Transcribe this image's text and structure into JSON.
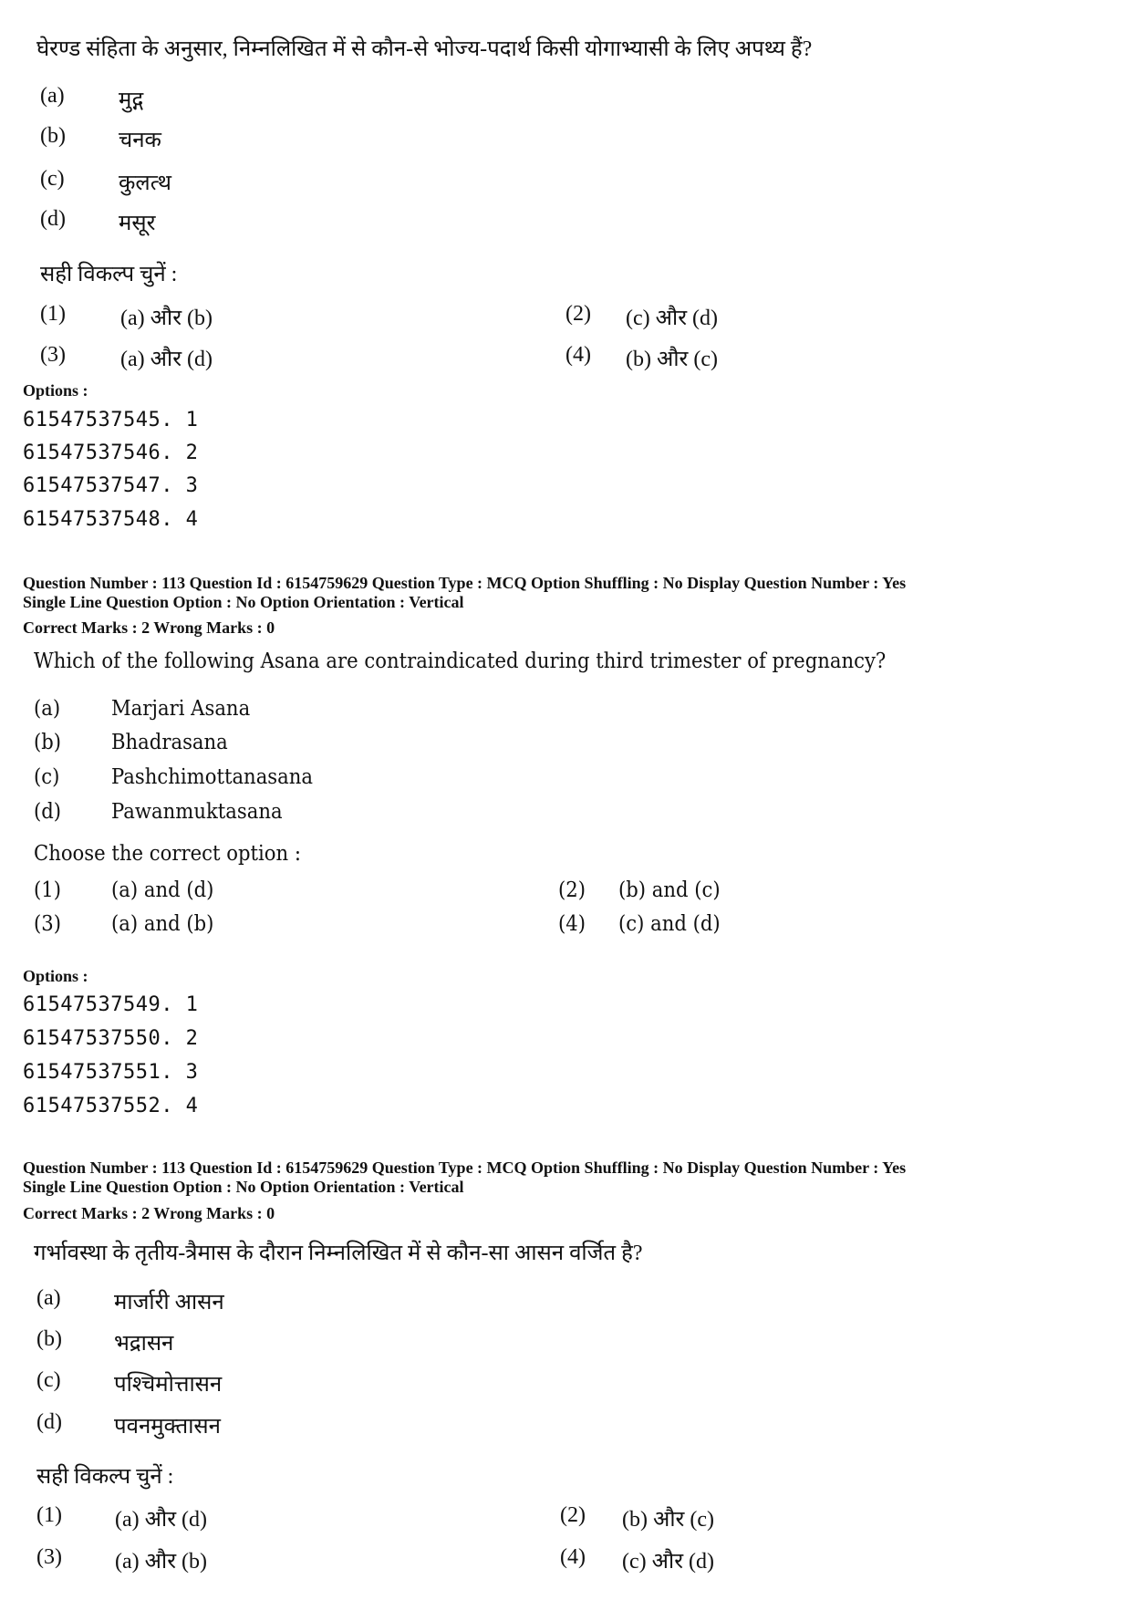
{
  "block1": {
    "question": "घेरण्ड संहिता के अनुसार, निम्नलिखित में से कौन-से भोज्य-पदार्थ किसी योगाभ्यासी के लिए अपथ्य हैं?",
    "items": [
      {
        "label": "(a)",
        "text": "मुद्ग"
      },
      {
        "label": "(b)",
        "text": "चनक"
      },
      {
        "label": "(c)",
        "text": "कुलत्थ"
      },
      {
        "label": "(d)",
        "text": "मसूर"
      }
    ],
    "choose_prompt": "सही विकल्प चुनें :",
    "answers": [
      {
        "num": "(1)",
        "text": "(a) और (b)"
      },
      {
        "num": "(2)",
        "text": "(c) और (d)"
      },
      {
        "num": "(3)",
        "text": "(a) और (d)"
      },
      {
        "num": "(4)",
        "text": "(b) और (c)"
      }
    ],
    "options_heading": "Options :",
    "option_ids": [
      "61547537545. 1",
      "61547537546. 2",
      "61547537547. 3",
      "61547537548. 4"
    ]
  },
  "block2": {
    "meta_line1": "Question Number : 113  Question Id : 6154759629  Question Type : MCQ  Option Shuffling : No  Display Question Number : Yes",
    "meta_line2": "Single Line Question Option : No  Option Orientation : Vertical",
    "marks": "Correct Marks : 2  Wrong Marks : 0",
    "question": "Which of the following Asana are contraindicated during third trimester of pregnancy?",
    "items": [
      {
        "label": "(a)",
        "text": "Marjari Asana"
      },
      {
        "label": "(b)",
        "text": "Bhadrasana"
      },
      {
        "label": "(c)",
        "text": "Pashchimottanasana"
      },
      {
        "label": "(d)",
        "text": "Pawanmuktasana"
      }
    ],
    "choose_prompt": "Choose the correct option :",
    "answers": [
      {
        "num": "(1)",
        "text": "(a) and (d)"
      },
      {
        "num": "(2)",
        "text": "(b) and (c)"
      },
      {
        "num": "(3)",
        "text": "(a) and (b)"
      },
      {
        "num": "(4)",
        "text": "(c) and (d)"
      }
    ],
    "options_heading": "Options :",
    "option_ids": [
      "61547537549. 1",
      "61547537550. 2",
      "61547537551. 3",
      "61547537552. 4"
    ]
  },
  "block3": {
    "meta_line1": "Question Number : 113  Question Id : 6154759629  Question Type : MCQ  Option Shuffling : No  Display Question Number : Yes",
    "meta_line2": "Single Line Question Option : No  Option Orientation : Vertical",
    "marks": "Correct Marks : 2  Wrong Marks : 0",
    "question": "गर्भावस्था के तृतीय-त्रैमास के दौरान निम्नलिखित में से कौन-सा आसन वर्जित है?",
    "items": [
      {
        "label": "(a)",
        "text": "मार्जारी आसन"
      },
      {
        "label": "(b)",
        "text": "भद्रासन"
      },
      {
        "label": "(c)",
        "text": "पश्चिमोत्तासन"
      },
      {
        "label": "(d)",
        "text": "पवनमुक्तासन"
      }
    ],
    "choose_prompt": "सही विकल्प चुनें :",
    "answers": [
      {
        "num": "(1)",
        "text": "(a) और (d)"
      },
      {
        "num": "(2)",
        "text": "(b) और (c)"
      },
      {
        "num": "(3)",
        "text": "(a) और (b)"
      },
      {
        "num": "(4)",
        "text": "(c) और (d)"
      }
    ]
  }
}
